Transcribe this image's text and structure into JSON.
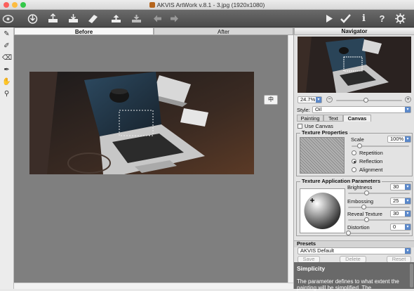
{
  "window": {
    "title": "AKVIS ArtWork v.8.1 - 3.jpg (1920x1080)"
  },
  "toolbar": {
    "icons": [
      "app-logo-icon",
      "open-icon",
      "save-icon",
      "print-icon",
      "share-icon",
      "upload-icon",
      "download-icon",
      "undo-icon",
      "redo-icon",
      "run-icon",
      "apply-icon",
      "info-icon",
      "help-icon",
      "settings-icon"
    ],
    "info_glyph": "i",
    "help_glyph": "?"
  },
  "tabs": {
    "before": "Before",
    "after": "After"
  },
  "canvas": {
    "compare_button": "中"
  },
  "navigator": {
    "title": "Navigator",
    "zoom": "24.7%",
    "minus": "−",
    "plus": "+",
    "zoom_level": 0.45
  },
  "style": {
    "label": "Style:",
    "value": "Oil"
  },
  "inner_tabs": [
    "Painting",
    "Text",
    "Canvas"
  ],
  "canvas_panel": {
    "use_canvas": "Use Canvas",
    "texture_properties": {
      "title": "Texture Properties",
      "scale_label": "Scale",
      "scale_value": "100%",
      "options": [
        "Repetition",
        "Reflection",
        "Alignment"
      ],
      "selected": "Reflection"
    },
    "texture_application": {
      "title": "Texture Application Parameters",
      "params": [
        {
          "label": "Brightness",
          "value": "30",
          "level": 0.3
        },
        {
          "label": "Embossing",
          "value": "25",
          "level": 0.25
        },
        {
          "label": "Reveal Texture",
          "value": "30",
          "level": 0.3
        },
        {
          "label": "Distortion",
          "value": "0",
          "level": 0.0
        }
      ]
    }
  },
  "presets": {
    "title": "Presets",
    "value": "AKVIS Default",
    "save": "Save",
    "delete": "Delete",
    "reset": "Reset"
  },
  "help": {
    "title": "Simplicity",
    "text": "The parameter defines to what extent the painting will be simplified. The"
  },
  "colors": {
    "toolbar_bg": "#555555",
    "canvas_bg": "#7f7f7f",
    "help_bg": "#696969",
    "accent": "#5b88c9"
  }
}
